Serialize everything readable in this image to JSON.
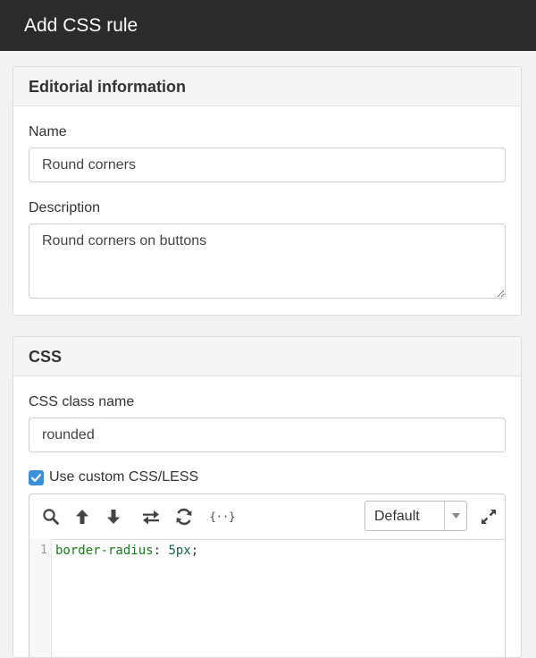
{
  "window": {
    "title": "Add CSS rule"
  },
  "editorial": {
    "heading": "Editorial information",
    "name_label": "Name",
    "name_value": "Round corners",
    "description_label": "Description",
    "description_value": "Round corners on buttons"
  },
  "css": {
    "heading": "CSS",
    "class_label": "CSS class name",
    "class_value": "rounded",
    "custom_label": "Use custom CSS/LESS",
    "custom_checked": true,
    "toolbar": {
      "icons": [
        "search-icon",
        "arrow-up-icon",
        "arrow-down-icon",
        "swap-icon",
        "refresh-icon",
        "braces-icon",
        "fullscreen-icon"
      ],
      "braces_glyph": "{··}",
      "theme_value": "Default"
    },
    "editor": {
      "line_number": "1",
      "property": "border-radius",
      "colon": ":",
      "value": "5px",
      "semicolon": ";"
    }
  },
  "colors": {
    "titlebar": "#2b2b2b",
    "accent": "#3b8ed8"
  }
}
